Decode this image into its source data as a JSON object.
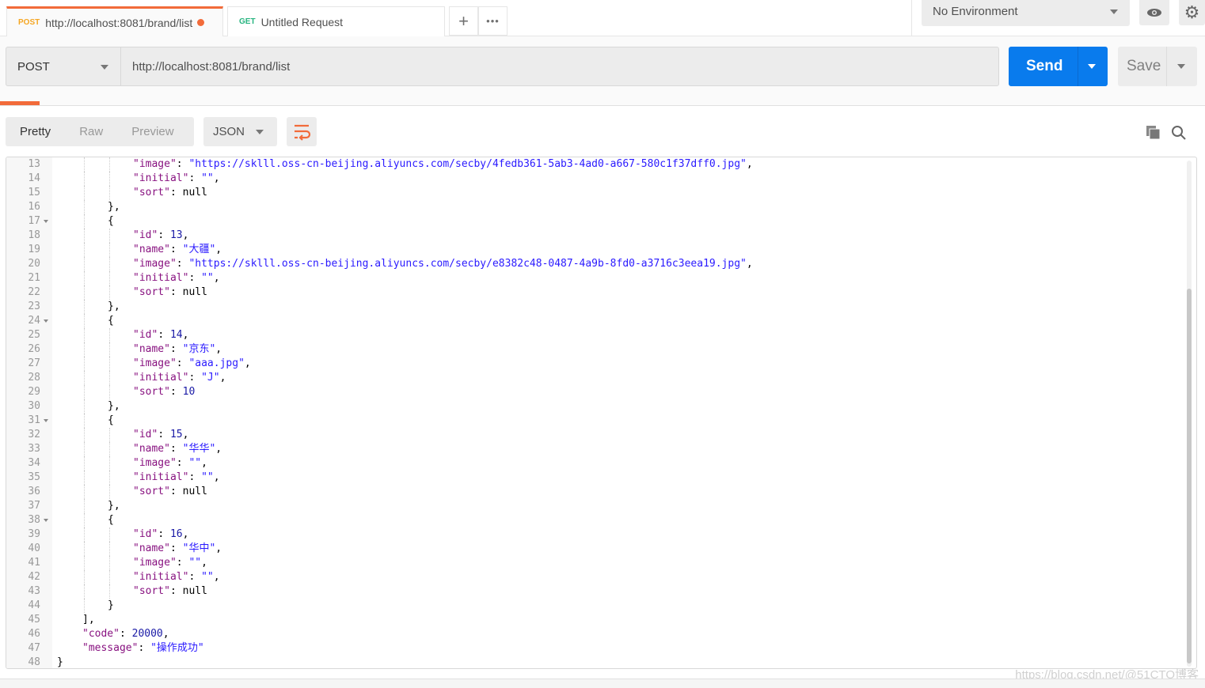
{
  "tabs": [
    {
      "method": "POST",
      "method_color": "#f5a623",
      "label": "http://localhost:8081/brand/list",
      "unsaved": true
    },
    {
      "method": "GET",
      "method_color": "#26b47f",
      "label": "Untitled Request"
    }
  ],
  "tab_actions": {
    "add": "+",
    "more": "•••"
  },
  "environment": {
    "selected": "No Environment"
  },
  "request": {
    "method": "POST",
    "url": "http://localhost:8081/brand/list",
    "send_label": "Send",
    "save_label": "Save"
  },
  "response_view": {
    "modes": [
      "Pretty",
      "Raw",
      "Preview"
    ],
    "active_mode": "Pretty",
    "format": "JSON"
  },
  "colors": {
    "accent": "#f26b3a",
    "send": "#097bed",
    "key": "#881280",
    "string": "#2a1aff",
    "number": "#1a1aa6"
  },
  "code_lines": [
    {
      "n": 13,
      "i": 12,
      "k": "image",
      "v": "\"https://sklll.oss-cn-beijing.aliyuncs.com/secby/4fedb361-5ab3-4ad0-a667-580c1f37dff0.jpg\"",
      "t": "s",
      "e": ","
    },
    {
      "n": 14,
      "i": 12,
      "k": "initial",
      "v": "\"\"",
      "t": "s",
      "e": ","
    },
    {
      "n": 15,
      "i": 12,
      "k": "sort",
      "v": "null",
      "t": "",
      "e": ""
    },
    {
      "n": 16,
      "i": 8,
      "p": "},"
    },
    {
      "n": 17,
      "i": 8,
      "p": "{",
      "fold": true
    },
    {
      "n": 18,
      "i": 12,
      "k": "id",
      "v": "13",
      "t": "n",
      "e": ","
    },
    {
      "n": 19,
      "i": 12,
      "k": "name",
      "v": "\"大疆\"",
      "t": "s",
      "e": ","
    },
    {
      "n": 20,
      "i": 12,
      "k": "image",
      "v": "\"https://sklll.oss-cn-beijing.aliyuncs.com/secby/e8382c48-0487-4a9b-8fd0-a3716c3eea19.jpg\"",
      "t": "s",
      "e": ","
    },
    {
      "n": 21,
      "i": 12,
      "k": "initial",
      "v": "\"\"",
      "t": "s",
      "e": ","
    },
    {
      "n": 22,
      "i": 12,
      "k": "sort",
      "v": "null",
      "t": "",
      "e": ""
    },
    {
      "n": 23,
      "i": 8,
      "p": "},"
    },
    {
      "n": 24,
      "i": 8,
      "p": "{",
      "fold": true
    },
    {
      "n": 25,
      "i": 12,
      "k": "id",
      "v": "14",
      "t": "n",
      "e": ","
    },
    {
      "n": 26,
      "i": 12,
      "k": "name",
      "v": "\"京东\"",
      "t": "s",
      "e": ","
    },
    {
      "n": 27,
      "i": 12,
      "k": "image",
      "v": "\"aaa.jpg\"",
      "t": "s",
      "e": ","
    },
    {
      "n": 28,
      "i": 12,
      "k": "initial",
      "v": "\"J\"",
      "t": "s",
      "e": ","
    },
    {
      "n": 29,
      "i": 12,
      "k": "sort",
      "v": "10",
      "t": "n",
      "e": ""
    },
    {
      "n": 30,
      "i": 8,
      "p": "},"
    },
    {
      "n": 31,
      "i": 8,
      "p": "{",
      "fold": true
    },
    {
      "n": 32,
      "i": 12,
      "k": "id",
      "v": "15",
      "t": "n",
      "e": ","
    },
    {
      "n": 33,
      "i": 12,
      "k": "name",
      "v": "\"华华\"",
      "t": "s",
      "e": ","
    },
    {
      "n": 34,
      "i": 12,
      "k": "image",
      "v": "\"\"",
      "t": "s",
      "e": ","
    },
    {
      "n": 35,
      "i": 12,
      "k": "initial",
      "v": "\"\"",
      "t": "s",
      "e": ","
    },
    {
      "n": 36,
      "i": 12,
      "k": "sort",
      "v": "null",
      "t": "",
      "e": ""
    },
    {
      "n": 37,
      "i": 8,
      "p": "},"
    },
    {
      "n": 38,
      "i": 8,
      "p": "{",
      "fold": true
    },
    {
      "n": 39,
      "i": 12,
      "k": "id",
      "v": "16",
      "t": "n",
      "e": ","
    },
    {
      "n": 40,
      "i": 12,
      "k": "name",
      "v": "\"华中\"",
      "t": "s",
      "e": ","
    },
    {
      "n": 41,
      "i": 12,
      "k": "image",
      "v": "\"\"",
      "t": "s",
      "e": ","
    },
    {
      "n": 42,
      "i": 12,
      "k": "initial",
      "v": "\"\"",
      "t": "s",
      "e": ","
    },
    {
      "n": 43,
      "i": 12,
      "k": "sort",
      "v": "null",
      "t": "",
      "e": ""
    },
    {
      "n": 44,
      "i": 8,
      "p": "}"
    },
    {
      "n": 45,
      "i": 4,
      "p": "],"
    },
    {
      "n": 46,
      "i": 4,
      "k": "code",
      "v": "20000",
      "t": "n",
      "e": ","
    },
    {
      "n": 47,
      "i": 4,
      "k": "message",
      "v": "\"操作成功\"",
      "t": "s",
      "e": ""
    },
    {
      "n": 48,
      "i": 0,
      "p": "}"
    }
  ],
  "watermark": "https://blog.csdn.net/@51CTO博客"
}
